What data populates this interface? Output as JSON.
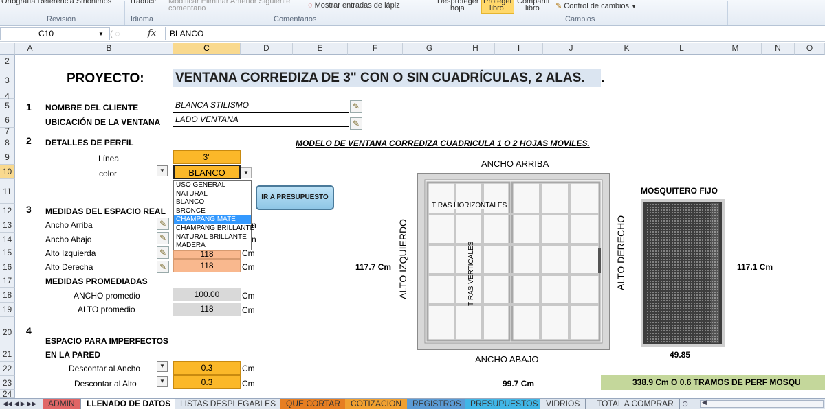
{
  "ribbon": {
    "partial_top_left": "Ortografía Referencia Sinónimos",
    "traducir": "Traducir",
    "comment_tools": "Modificar   Eliminar  Anterior Siguiente",
    "comentario": "comentario",
    "mostrar_lapiz": "Mostrar entradas de lápiz",
    "desproteger": "Desproteger",
    "hoja": "hoja",
    "proteger": "Proteger",
    "libro": "libro",
    "compartir": "Compartir",
    "libro2": "libro",
    "control_cambios": "Control de cambios",
    "groups": {
      "revision": "Revisión",
      "idioma": "Idioma",
      "comentarios": "Comentarios",
      "cambios": "Cambios"
    }
  },
  "formula_bar": {
    "name_box": "C10",
    "fx": "fx",
    "value": "BLANCO"
  },
  "columns": [
    "A",
    "B",
    "C",
    "D",
    "E",
    "F",
    "G",
    "H",
    "I",
    "J",
    "K",
    "L",
    "M",
    "N",
    "O"
  ],
  "rows": [
    "2",
    "3",
    "4",
    "5",
    "6",
    "7",
    "8",
    "9",
    "10",
    "11",
    "12",
    "13",
    "14",
    "15",
    "16",
    "17",
    "18",
    "19",
    "20",
    "21",
    "22",
    "23",
    "24"
  ],
  "sheet": {
    "proyecto_label": "PROYECTO:",
    "proyecto_title": "VENTANA CORREDIZA DE 3\"  CON O SIN CUADRÍCULAS,  2 ALAS.",
    "s1_num": "1",
    "nombre_cliente_label": "NOMBRE DEL CLIENTE",
    "nombre_cliente_value": "BLANCA STILISMO",
    "ubicacion_label": "UBICACIÓN DE LA VENTANA",
    "ubicacion_value": "LADO VENTANA",
    "s2_num": "2",
    "detalles_label": "DETALLES DE PERFIL",
    "linea_label": "Línea",
    "linea_value": "3\"",
    "color_label": "color",
    "color_value": "BLANCO",
    "color_options": [
      "USO GENERAL",
      "NATURAL",
      "BLANCO",
      "BRONCE",
      "CHAMPANG MATE",
      "CHAMPANG BRILLANTE",
      "NATURAL BRILLANTE",
      "MADERA"
    ],
    "color_selected_option": "CHAMPANG MATE",
    "ir_presupuesto": "IR A PRESUPUESTO",
    "s3_num": "3",
    "medidas_label": "MEDIDAS DEL ESPACIO REAL",
    "ancho_arriba_label": "Ancho Arriba",
    "ancho_abajo_label": "Ancho Abajo",
    "alto_izq_label": "Alto Izquierda",
    "alto_izq_value": "118",
    "alto_der_label": "Alto Derecha",
    "alto_der_value": "118",
    "unit_cm": "Cm",
    "promediadas_label": "MEDIDAS PROMEDIADAS",
    "ancho_prom_label": "ANCHO promedio",
    "ancho_prom_value": "100.00",
    "alto_prom_label": "ALTO promedio",
    "alto_prom_value": "118",
    "s4_num": "4",
    "espacio_label": "ESPACIO PARA IMPERFECTOS",
    "en_pared_label": "EN LA PARED",
    "descontar_ancho_label": "Descontar al Ancho",
    "descontar_ancho_value": "0.3",
    "descontar_alto_label": "Descontar al Alto",
    "descontar_alto_value": "0.3"
  },
  "diagram": {
    "title": "MODELO DE VENTANA CORREDIZA CUADRICULA 1 O 2 HOJAS MOVILES.",
    "ancho_arriba": "ANCHO ARRIBA",
    "ancho_abajo": "ANCHO ABAJO",
    "alto_izquierdo": "ALTO IZQUIERDO",
    "alto_derecho": "ALTO DERECHO",
    "tiras_horizontales": "TIRAS HORIZONTALES",
    "tiras_verticales": "TIRAS VERTICALES",
    "left_measure": "117.7 Cm",
    "right_measure": "117.1 Cm",
    "bottom_measure": "99.7 Cm",
    "mosquitero_title": "MOSQUITERO FIJO",
    "mosquitero_width": "49.85",
    "tramos": "338.9 Cm  O 0.6 TRAMOS DE PERF MOSQU"
  },
  "tabs": [
    {
      "label": "ADMIN",
      "color": "#e06666"
    },
    {
      "label": "LLENADO DE DATOS",
      "color": "#ffffff"
    },
    {
      "label": "LISTAS DESPLEGABLES",
      "color": "#dfe6ef"
    },
    {
      "label": "QUE CORTAR",
      "color": "#e67e22"
    },
    {
      "label": "COTIZACION",
      "color": "#f0a030"
    },
    {
      "label": "REGISTROS",
      "color": "#5b9bd5"
    },
    {
      "label": "PRESUPUESTOS",
      "color": "#41b6e6"
    },
    {
      "label": "VIDRIOS",
      "color": "#dfe6ef"
    },
    {
      "label": "TOTAL A COMPRAR",
      "color": "#dfe6ef"
    }
  ]
}
